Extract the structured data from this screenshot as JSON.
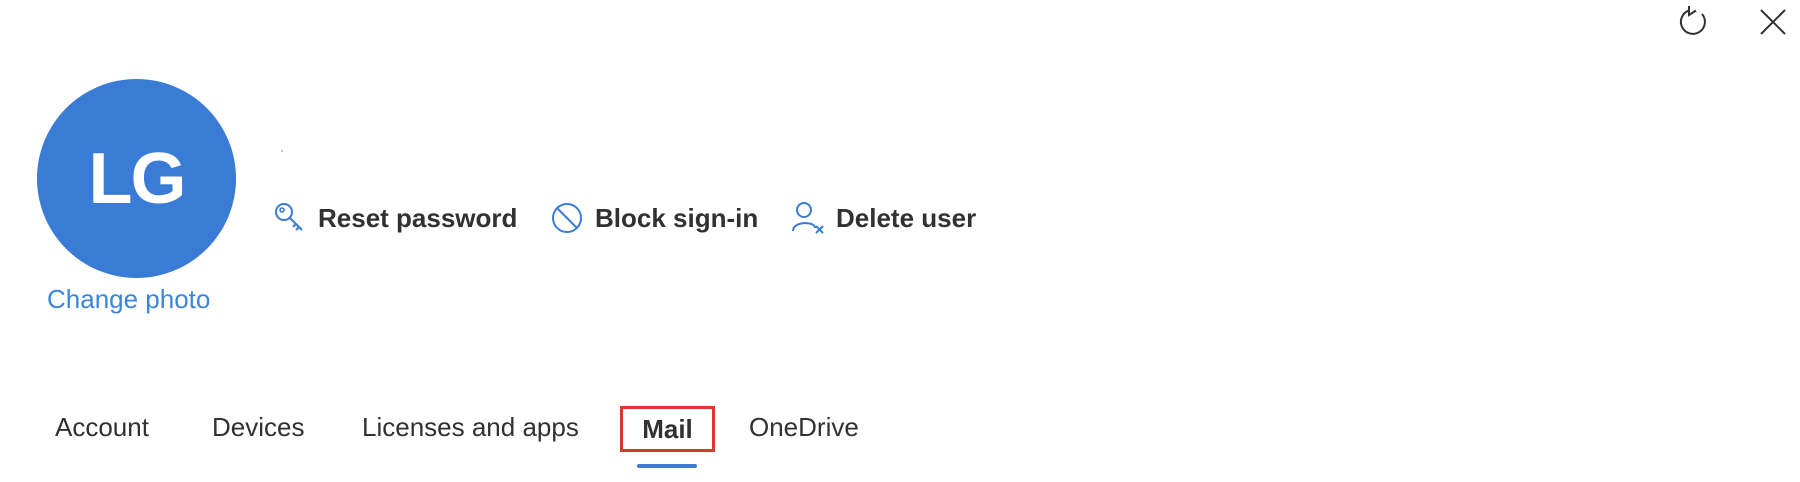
{
  "window_controls": {
    "refresh_icon": "refresh-icon",
    "close_icon": "close-icon"
  },
  "profile": {
    "initials": "LG",
    "change_photo_label": "Change photo",
    "avatar_color": "#3a7bd5"
  },
  "commands": [
    {
      "label": "Reset password",
      "icon": "key-icon"
    },
    {
      "label": "Block sign-in",
      "icon": "block-icon"
    },
    {
      "label": "Delete user",
      "icon": "delete-user-icon"
    }
  ],
  "tabs": [
    {
      "label": "Account"
    },
    {
      "label": "Devices"
    },
    {
      "label": "Licenses and apps"
    },
    {
      "label": "Mail",
      "selected": true
    },
    {
      "label": "OneDrive"
    }
  ],
  "colors": {
    "accent": "#3a7bd5",
    "link": "#3a86d8",
    "highlight_box": "#d83b2a"
  }
}
